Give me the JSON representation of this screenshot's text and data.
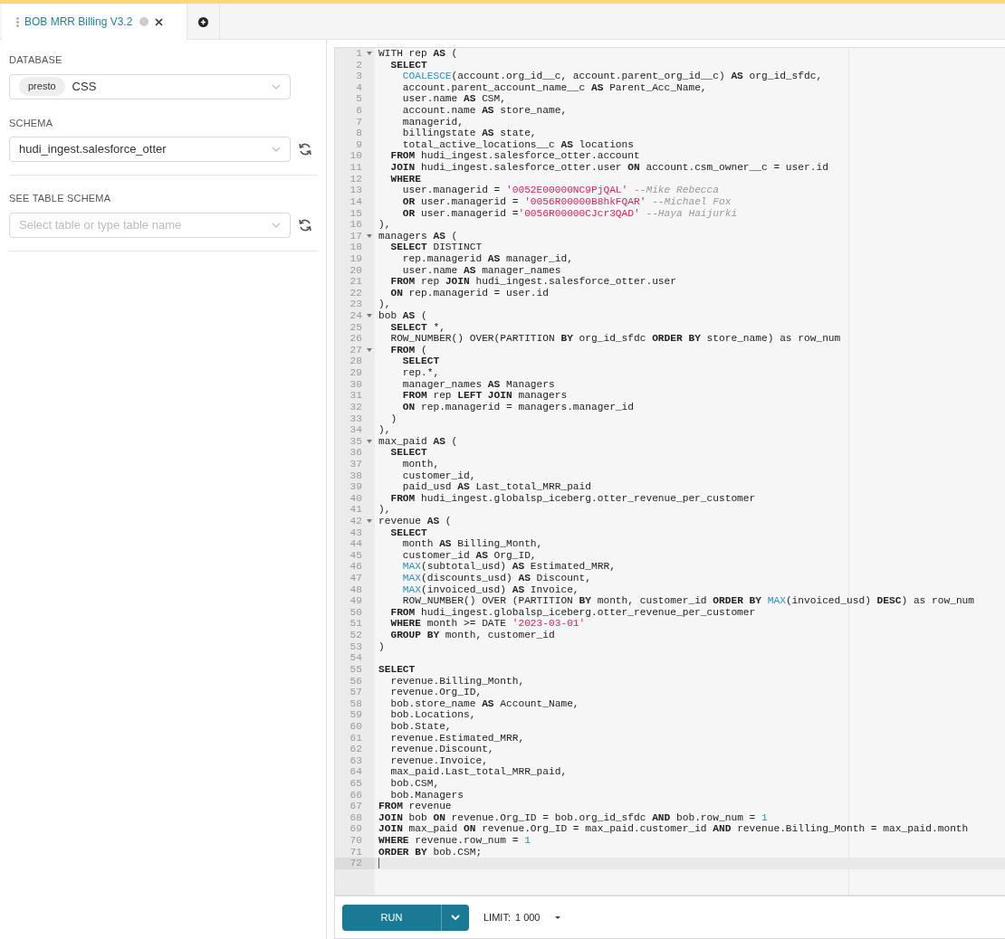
{
  "tabs": [
    {
      "title": "BOB MRR Billing V3.2",
      "selected": true
    }
  ],
  "sidebar": {
    "database": {
      "label": "DATABASE",
      "badge": "presto",
      "value": "CSS"
    },
    "schema": {
      "label": "SCHEMA",
      "value": "hudi_ingest.salesforce_otter"
    },
    "table_schema": {
      "label": "SEE TABLE SCHEMA",
      "placeholder": "Select table or type table name"
    }
  },
  "editor": {
    "lines": [
      {
        "number": "1",
        "fold": true,
        "active": false,
        "segments": [
          {
            "kind": "plain",
            "text": "WITH rep "
          },
          {
            "kind": "keyword",
            "text": "AS"
          },
          {
            "kind": "plain",
            "text": " ("
          }
        ]
      },
      {
        "number": "2",
        "fold": false,
        "active": false,
        "segments": [
          {
            "kind": "keyword",
            "text": "  SELECT"
          }
        ]
      },
      {
        "number": "3",
        "fold": false,
        "active": false,
        "segments": [
          {
            "kind": "function",
            "text": "    COALESCE"
          },
          {
            "kind": "plain",
            "text": "(account.org_id__c, account.parent_org_id__c) "
          },
          {
            "kind": "keyword",
            "text": "AS"
          },
          {
            "kind": "plain",
            "text": " org_id_sfdc,"
          }
        ]
      },
      {
        "number": "4",
        "fold": false,
        "active": false,
        "segments": [
          {
            "kind": "plain",
            "text": "    account.parent_account_name__c "
          },
          {
            "kind": "keyword",
            "text": "AS"
          },
          {
            "kind": "plain",
            "text": " Parent_Acc_Name,"
          }
        ]
      },
      {
        "number": "5",
        "fold": false,
        "active": false,
        "segments": [
          {
            "kind": "plain",
            "text": "    user.name "
          },
          {
            "kind": "keyword",
            "text": "AS"
          },
          {
            "kind": "plain",
            "text": " CSM,"
          }
        ]
      },
      {
        "number": "6",
        "fold": false,
        "active": false,
        "segments": [
          {
            "kind": "plain",
            "text": "    account.name "
          },
          {
            "kind": "keyword",
            "text": "AS"
          },
          {
            "kind": "plain",
            "text": " store_name,"
          }
        ]
      },
      {
        "number": "7",
        "fold": false,
        "active": false,
        "segments": [
          {
            "kind": "plain",
            "text": "    managerid,"
          }
        ]
      },
      {
        "number": "8",
        "fold": false,
        "active": false,
        "segments": [
          {
            "kind": "plain",
            "text": "    billingstate "
          },
          {
            "kind": "keyword",
            "text": "AS"
          },
          {
            "kind": "plain",
            "text": " state,"
          }
        ]
      },
      {
        "number": "9",
        "fold": false,
        "active": false,
        "segments": [
          {
            "kind": "plain",
            "text": "    total_active_locations__c "
          },
          {
            "kind": "keyword",
            "text": "AS"
          },
          {
            "kind": "plain",
            "text": " locations"
          }
        ]
      },
      {
        "number": "10",
        "fold": false,
        "active": false,
        "segments": [
          {
            "kind": "keyword",
            "text": "  FROM"
          },
          {
            "kind": "plain",
            "text": " hudi_ingest.salesforce_otter.account"
          }
        ]
      },
      {
        "number": "11",
        "fold": false,
        "active": false,
        "segments": [
          {
            "kind": "keyword",
            "text": "  JOIN"
          },
          {
            "kind": "plain",
            "text": " hudi_ingest.salesforce_otter.user "
          },
          {
            "kind": "keyword",
            "text": "ON"
          },
          {
            "kind": "plain",
            "text": " account.csm_owner__c = user.id"
          }
        ]
      },
      {
        "number": "12",
        "fold": false,
        "active": false,
        "segments": [
          {
            "kind": "keyword",
            "text": "  WHERE"
          }
        ]
      },
      {
        "number": "13",
        "fold": false,
        "active": false,
        "segments": [
          {
            "kind": "plain",
            "text": "    user.managerid = "
          },
          {
            "kind": "string",
            "text": "'0052E00000NC9PjQAL'"
          },
          {
            "kind": "comment",
            "text": " --Mike Rebecca"
          }
        ]
      },
      {
        "number": "14",
        "fold": false,
        "active": false,
        "segments": [
          {
            "kind": "keyword",
            "text": "    OR"
          },
          {
            "kind": "plain",
            "text": " user.managerid = "
          },
          {
            "kind": "string",
            "text": "'0056R00000B8hkFQAR'"
          },
          {
            "kind": "comment",
            "text": " --Michael Fox"
          }
        ]
      },
      {
        "number": "15",
        "fold": false,
        "active": false,
        "segments": [
          {
            "kind": "keyword",
            "text": "    OR"
          },
          {
            "kind": "plain",
            "text": " user.managerid ="
          },
          {
            "kind": "string",
            "text": "'0056R00000CJcr3QAD'"
          },
          {
            "kind": "comment",
            "text": " --Haya Haijurki"
          }
        ]
      },
      {
        "number": "16",
        "fold": false,
        "active": false,
        "segments": [
          {
            "kind": "plain",
            "text": "),"
          }
        ]
      },
      {
        "number": "17",
        "fold": true,
        "active": false,
        "segments": [
          {
            "kind": "plain",
            "text": "managers "
          },
          {
            "kind": "keyword",
            "text": "AS"
          },
          {
            "kind": "plain",
            "text": " ("
          }
        ]
      },
      {
        "number": "18",
        "fold": false,
        "active": false,
        "segments": [
          {
            "kind": "keyword",
            "text": "  SELECT"
          },
          {
            "kind": "plain",
            "text": " DISTINCT"
          }
        ]
      },
      {
        "number": "19",
        "fold": false,
        "active": false,
        "segments": [
          {
            "kind": "plain",
            "text": "    rep.managerid "
          },
          {
            "kind": "keyword",
            "text": "AS"
          },
          {
            "kind": "plain",
            "text": " manager_id,"
          }
        ]
      },
      {
        "number": "20",
        "fold": false,
        "active": false,
        "segments": [
          {
            "kind": "plain",
            "text": "    user.name "
          },
          {
            "kind": "keyword",
            "text": "AS"
          },
          {
            "kind": "plain",
            "text": " manager_names"
          }
        ]
      },
      {
        "number": "21",
        "fold": false,
        "active": false,
        "segments": [
          {
            "kind": "keyword",
            "text": "  FROM"
          },
          {
            "kind": "plain",
            "text": " rep "
          },
          {
            "kind": "keyword",
            "text": "JOIN"
          },
          {
            "kind": "plain",
            "text": " hudi_ingest.salesforce_otter.user"
          }
        ]
      },
      {
        "number": "22",
        "fold": false,
        "active": false,
        "segments": [
          {
            "kind": "keyword",
            "text": "  ON"
          },
          {
            "kind": "plain",
            "text": " rep.managerid = user.id"
          }
        ]
      },
      {
        "number": "23",
        "fold": false,
        "active": false,
        "segments": [
          {
            "kind": "plain",
            "text": "),"
          }
        ]
      },
      {
        "number": "24",
        "fold": true,
        "active": false,
        "segments": [
          {
            "kind": "plain",
            "text": "bob "
          },
          {
            "kind": "keyword",
            "text": "AS"
          },
          {
            "kind": "plain",
            "text": " ("
          }
        ]
      },
      {
        "number": "25",
        "fold": false,
        "active": false,
        "segments": [
          {
            "kind": "keyword",
            "text": "  SELECT"
          },
          {
            "kind": "plain",
            "text": " *,"
          }
        ]
      },
      {
        "number": "26",
        "fold": false,
        "active": false,
        "segments": [
          {
            "kind": "plain",
            "text": "  ROW_NUMBER() OVER(PARTITION "
          },
          {
            "kind": "keyword",
            "text": "BY"
          },
          {
            "kind": "plain",
            "text": " org_id_sfdc "
          },
          {
            "kind": "keyword",
            "text": "ORDER BY"
          },
          {
            "kind": "plain",
            "text": " store_name) as row_num"
          }
        ]
      },
      {
        "number": "27",
        "fold": true,
        "active": false,
        "segments": [
          {
            "kind": "keyword",
            "text": "  FROM"
          },
          {
            "kind": "plain",
            "text": " ("
          }
        ]
      },
      {
        "number": "28",
        "fold": false,
        "active": false,
        "segments": [
          {
            "kind": "keyword",
            "text": "    SELECT"
          }
        ]
      },
      {
        "number": "29",
        "fold": false,
        "active": false,
        "segments": [
          {
            "kind": "plain",
            "text": "    rep.*,"
          }
        ]
      },
      {
        "number": "30",
        "fold": false,
        "active": false,
        "segments": [
          {
            "kind": "plain",
            "text": "    manager_names "
          },
          {
            "kind": "keyword",
            "text": "AS"
          },
          {
            "kind": "plain",
            "text": " Managers"
          }
        ]
      },
      {
        "number": "31",
        "fold": false,
        "active": false,
        "segments": [
          {
            "kind": "keyword",
            "text": "    FROM"
          },
          {
            "kind": "plain",
            "text": " rep "
          },
          {
            "kind": "keyword",
            "text": "LEFT JOIN"
          },
          {
            "kind": "plain",
            "text": " managers"
          }
        ]
      },
      {
        "number": "32",
        "fold": false,
        "active": false,
        "segments": [
          {
            "kind": "keyword",
            "text": "    ON"
          },
          {
            "kind": "plain",
            "text": " rep.managerid = managers.manager_id"
          }
        ]
      },
      {
        "number": "33",
        "fold": false,
        "active": false,
        "segments": [
          {
            "kind": "plain",
            "text": "  )"
          }
        ]
      },
      {
        "number": "34",
        "fold": false,
        "active": false,
        "segments": [
          {
            "kind": "plain",
            "text": "),"
          }
        ]
      },
      {
        "number": "35",
        "fold": true,
        "active": false,
        "segments": [
          {
            "kind": "plain",
            "text": "max_paid "
          },
          {
            "kind": "keyword",
            "text": "AS"
          },
          {
            "kind": "plain",
            "text": " ("
          }
        ]
      },
      {
        "number": "36",
        "fold": false,
        "active": false,
        "segments": [
          {
            "kind": "keyword",
            "text": "  SELECT"
          }
        ]
      },
      {
        "number": "37",
        "fold": false,
        "active": false,
        "segments": [
          {
            "kind": "plain",
            "text": "    month,"
          }
        ]
      },
      {
        "number": "38",
        "fold": false,
        "active": false,
        "segments": [
          {
            "kind": "plain",
            "text": "    customer_id,"
          }
        ]
      },
      {
        "number": "39",
        "fold": false,
        "active": false,
        "segments": [
          {
            "kind": "plain",
            "text": "    paid_usd "
          },
          {
            "kind": "keyword",
            "text": "AS"
          },
          {
            "kind": "plain",
            "text": " Last_total_MRR_paid"
          }
        ]
      },
      {
        "number": "40",
        "fold": false,
        "active": false,
        "segments": [
          {
            "kind": "keyword",
            "text": "  FROM"
          },
          {
            "kind": "plain",
            "text": " hudi_ingest.globalsp_iceberg.otter_revenue_per_customer"
          }
        ]
      },
      {
        "number": "41",
        "fold": false,
        "active": false,
        "segments": [
          {
            "kind": "plain",
            "text": "),"
          }
        ]
      },
      {
        "number": "42",
        "fold": true,
        "active": false,
        "segments": [
          {
            "kind": "plain",
            "text": "revenue "
          },
          {
            "kind": "keyword",
            "text": "AS"
          },
          {
            "kind": "plain",
            "text": " ("
          }
        ]
      },
      {
        "number": "43",
        "fold": false,
        "active": false,
        "segments": [
          {
            "kind": "keyword",
            "text": "  SELECT"
          }
        ]
      },
      {
        "number": "44",
        "fold": false,
        "active": false,
        "segments": [
          {
            "kind": "plain",
            "text": "    month "
          },
          {
            "kind": "keyword",
            "text": "AS"
          },
          {
            "kind": "plain",
            "text": " Billing_Month,"
          }
        ]
      },
      {
        "number": "45",
        "fold": false,
        "active": false,
        "segments": [
          {
            "kind": "plain",
            "text": "    customer_id "
          },
          {
            "kind": "keyword",
            "text": "AS"
          },
          {
            "kind": "plain",
            "text": " Org_ID,"
          }
        ]
      },
      {
        "number": "46",
        "fold": false,
        "active": false,
        "segments": [
          {
            "kind": "function",
            "text": "    MAX"
          },
          {
            "kind": "plain",
            "text": "(subtotal_usd) "
          },
          {
            "kind": "keyword",
            "text": "AS"
          },
          {
            "kind": "plain",
            "text": " Estimated_MRR,"
          }
        ]
      },
      {
        "number": "47",
        "fold": false,
        "active": false,
        "segments": [
          {
            "kind": "function",
            "text": "    MAX"
          },
          {
            "kind": "plain",
            "text": "(discounts_usd) "
          },
          {
            "kind": "keyword",
            "text": "AS"
          },
          {
            "kind": "plain",
            "text": " Discount,"
          }
        ]
      },
      {
        "number": "48",
        "fold": false,
        "active": false,
        "segments": [
          {
            "kind": "function",
            "text": "    MAX"
          },
          {
            "kind": "plain",
            "text": "(invoiced_usd) "
          },
          {
            "kind": "keyword",
            "text": "AS"
          },
          {
            "kind": "plain",
            "text": " Invoice,"
          }
        ]
      },
      {
        "number": "49",
        "fold": false,
        "active": false,
        "segments": [
          {
            "kind": "plain",
            "text": "    ROW_NUMBER() OVER (PARTITION "
          },
          {
            "kind": "keyword",
            "text": "BY"
          },
          {
            "kind": "plain",
            "text": " month, customer_id "
          },
          {
            "kind": "keyword",
            "text": "ORDER BY "
          },
          {
            "kind": "function",
            "text": "MAX"
          },
          {
            "kind": "plain",
            "text": "(invoiced_usd) "
          },
          {
            "kind": "keyword",
            "text": "DESC"
          },
          {
            "kind": "plain",
            "text": ") as row_num"
          }
        ]
      },
      {
        "number": "50",
        "fold": false,
        "active": false,
        "segments": [
          {
            "kind": "keyword",
            "text": "  FROM"
          },
          {
            "kind": "plain",
            "text": " hudi_ingest.globalsp_iceberg.otter_revenue_per_customer"
          }
        ]
      },
      {
        "number": "51",
        "fold": false,
        "active": false,
        "segments": [
          {
            "kind": "keyword",
            "text": "  WHERE"
          },
          {
            "kind": "plain",
            "text": " month >= DATE "
          },
          {
            "kind": "string",
            "text": "'2023-03-01'"
          }
        ]
      },
      {
        "number": "52",
        "fold": false,
        "active": false,
        "segments": [
          {
            "kind": "keyword",
            "text": "  GROUP BY"
          },
          {
            "kind": "plain",
            "text": " month, customer_id"
          }
        ]
      },
      {
        "number": "53",
        "fold": false,
        "active": false,
        "segments": [
          {
            "kind": "plain",
            "text": ")"
          }
        ]
      },
      {
        "number": "54",
        "fold": false,
        "active": false
      },
      {
        "number": "55",
        "fold": false,
        "active": false,
        "segments": [
          {
            "kind": "keyword",
            "text": "SELECT"
          }
        ]
      },
      {
        "number": "56",
        "fold": false,
        "active": false,
        "segments": [
          {
            "kind": "plain",
            "text": "  revenue.Billing_Month,"
          }
        ]
      },
      {
        "number": "57",
        "fold": false,
        "active": false,
        "segments": [
          {
            "kind": "plain",
            "text": "  revenue.Org_ID,"
          }
        ]
      },
      {
        "number": "58",
        "fold": false,
        "active": false,
        "segments": [
          {
            "kind": "plain",
            "text": "  bob.store_name "
          },
          {
            "kind": "keyword",
            "text": "AS"
          },
          {
            "kind": "plain",
            "text": " Account_Name,"
          }
        ]
      },
      {
        "number": "59",
        "fold": false,
        "active": false,
        "segments": [
          {
            "kind": "plain",
            "text": "  bob.Locations,"
          }
        ]
      },
      {
        "number": "60",
        "fold": false,
        "active": false,
        "segments": [
          {
            "kind": "plain",
            "text": "  bob.State,"
          }
        ]
      },
      {
        "number": "61",
        "fold": false,
        "active": false,
        "segments": [
          {
            "kind": "plain",
            "text": "  revenue.Estimated_MRR,"
          }
        ]
      },
      {
        "number": "62",
        "fold": false,
        "active": false,
        "segments": [
          {
            "kind": "plain",
            "text": "  revenue.Discount,"
          }
        ]
      },
      {
        "number": "63",
        "fold": false,
        "active": false,
        "segments": [
          {
            "kind": "plain",
            "text": "  revenue.Invoice,"
          }
        ]
      },
      {
        "number": "64",
        "fold": false,
        "active": false,
        "segments": [
          {
            "kind": "plain",
            "text": "  max_paid.Last_total_MRR_paid,"
          }
        ]
      },
      {
        "number": "65",
        "fold": false,
        "active": false,
        "segments": [
          {
            "kind": "plain",
            "text": "  bob.CSM,"
          }
        ]
      },
      {
        "number": "66",
        "fold": false,
        "active": false,
        "segments": [
          {
            "kind": "plain",
            "text": "  bob.Managers"
          }
        ]
      },
      {
        "number": "67",
        "fold": false,
        "active": false,
        "segments": [
          {
            "kind": "keyword",
            "text": "FROM"
          },
          {
            "kind": "plain",
            "text": " revenue"
          }
        ]
      },
      {
        "number": "68",
        "fold": false,
        "active": false,
        "segments": [
          {
            "kind": "keyword",
            "text": "JOIN"
          },
          {
            "kind": "plain",
            "text": " bob "
          },
          {
            "kind": "keyword",
            "text": "ON"
          },
          {
            "kind": "plain",
            "text": " revenue.Org_ID = bob.org_id_sfdc "
          },
          {
            "kind": "keyword",
            "text": "AND"
          },
          {
            "kind": "plain",
            "text": " bob.row_num = "
          },
          {
            "kind": "number",
            "text": "1"
          }
        ]
      },
      {
        "number": "69",
        "fold": false,
        "active": false,
        "segments": [
          {
            "kind": "keyword",
            "text": "JOIN"
          },
          {
            "kind": "plain",
            "text": " max_paid "
          },
          {
            "kind": "keyword",
            "text": "ON"
          },
          {
            "kind": "plain",
            "text": " revenue.Org_ID = max_paid.customer_id "
          },
          {
            "kind": "keyword",
            "text": "AND"
          },
          {
            "kind": "plain",
            "text": " revenue.Billing_Month = max_paid.month"
          }
        ]
      },
      {
        "number": "70",
        "fold": false,
        "active": false,
        "segments": [
          {
            "kind": "keyword",
            "text": "WHERE"
          },
          {
            "kind": "plain",
            "text": " revenue.row_num = "
          },
          {
            "kind": "number",
            "text": "1"
          }
        ]
      },
      {
        "number": "71",
        "fold": false,
        "active": false,
        "segments": [
          {
            "kind": "keyword",
            "text": "ORDER BY"
          },
          {
            "kind": "plain",
            "text": " bob.CSM;"
          }
        ]
      },
      {
        "number": "72",
        "fold": false,
        "active": true
      }
    ]
  },
  "footer": {
    "run_button": "RUN",
    "limit_label": "LIMIT:",
    "limit_value": "1 000"
  }
}
